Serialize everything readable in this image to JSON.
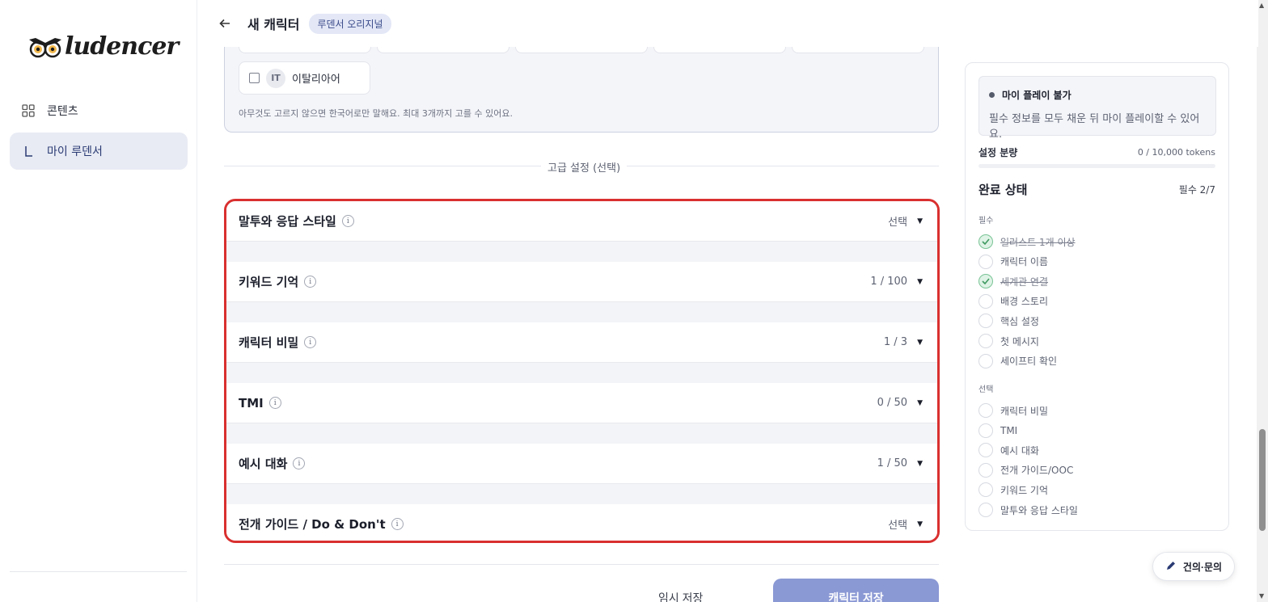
{
  "brand": {
    "name": "ludencer"
  },
  "sidebar": {
    "items": [
      {
        "label": "콘텐츠"
      },
      {
        "label": "마이 루덴서"
      }
    ]
  },
  "header": {
    "title": "새 캐릭터",
    "badge": "루덴서 오리지널"
  },
  "languages": {
    "chip": {
      "code": "IT",
      "name": "이탈리아어",
      "checked": false
    },
    "hint": "아무것도 고르지 않으면 한국어로만 말해요. 최대 3개까지 고를 수 있어요."
  },
  "advanced": {
    "label": "고급 설정 (선택)",
    "rows": [
      {
        "title": "말투와 응답 스타일",
        "value": "선택"
      },
      {
        "title": "키워드 기억",
        "value": "1 / 100"
      },
      {
        "title": "캐릭터 비밀",
        "value": "1 / 3"
      },
      {
        "title": "TMI",
        "value": "0 / 50"
      },
      {
        "title": "예시 대화",
        "value": "1 / 50"
      },
      {
        "title": "전개 가이드 / Do & Don't",
        "value": "선택"
      }
    ]
  },
  "actions": {
    "temp_save": "임시 저장",
    "save": "캐릭터 저장"
  },
  "status": {
    "title": "마이 플레이 불가",
    "desc": "필수 정보를 모두 채운 뒤 마이 플레이할 수 있어요."
  },
  "tokens": {
    "label": "설정 분량",
    "value": "0 / 10,000 tokens",
    "fill_fraction": 0
  },
  "completion": {
    "title": "완료 상태",
    "count": "필수 2/7",
    "required_label": "필수",
    "required": [
      {
        "label": "일러스트 1개 이상",
        "done": true
      },
      {
        "label": "캐릭터 이름",
        "done": false
      },
      {
        "label": "세계관 연결",
        "done": true
      },
      {
        "label": "배경 스토리",
        "done": false
      },
      {
        "label": "핵심 설정",
        "done": false
      },
      {
        "label": "첫 메시지",
        "done": false
      },
      {
        "label": "세이프티 확인",
        "done": false
      }
    ],
    "optional_label": "선택",
    "optional": [
      {
        "label": "캐릭터 비밀",
        "done": false
      },
      {
        "label": "TMI",
        "done": false
      },
      {
        "label": "예시 대화",
        "done": false
      },
      {
        "label": "전개 가이드/OOC",
        "done": false
      },
      {
        "label": "키워드 기억",
        "done": false
      },
      {
        "label": "말투와 응답 스타일",
        "done": false
      }
    ]
  },
  "feedback": {
    "label": "건의·문의"
  },
  "colors": {
    "accent": "#8a98d4",
    "highlight_border": "#d9302f",
    "done_green": "#79c495"
  }
}
